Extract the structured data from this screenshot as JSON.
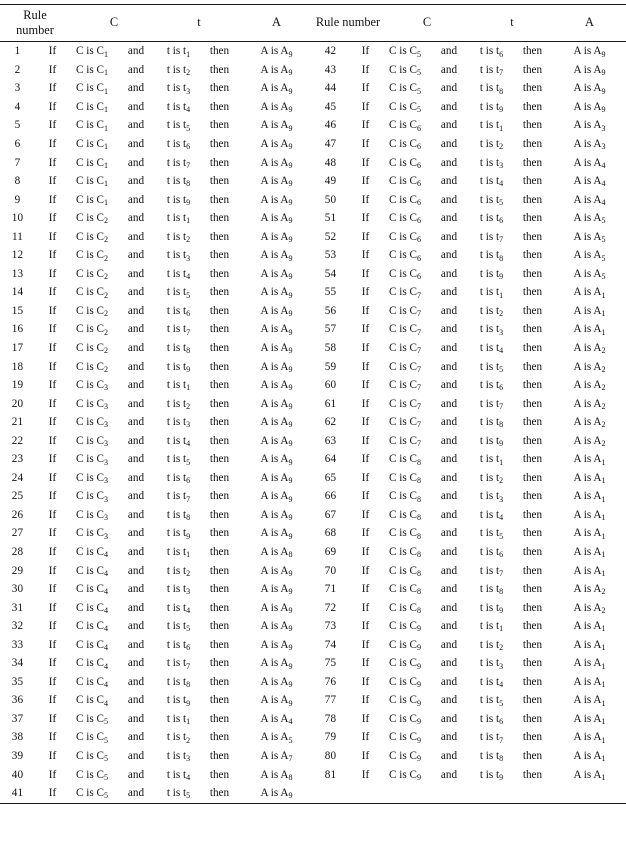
{
  "table": {
    "headers_left": {
      "rule_number_line1": "Rule",
      "rule_number_line2": "number",
      "c": "C",
      "t": "t",
      "a": "A"
    },
    "headers_right": {
      "rule_number": "Rule number",
      "c": "C",
      "t": "t",
      "a": "A"
    },
    "keywords": {
      "if": "If",
      "and": "and",
      "then": "then",
      "c_is": "C is C",
      "t_is": "t is t",
      "a_is": "A is A"
    },
    "rows_left": [
      {
        "n": "1",
        "c": "1",
        "t": "1",
        "a": "9"
      },
      {
        "n": "2",
        "c": "1",
        "t": "2",
        "a": "9"
      },
      {
        "n": "3",
        "c": "1",
        "t": "3",
        "a": "9"
      },
      {
        "n": "4",
        "c": "1",
        "t": "4",
        "a": "9"
      },
      {
        "n": "5",
        "c": "1",
        "t": "5",
        "a": "9"
      },
      {
        "n": "6",
        "c": "1",
        "t": "6",
        "a": "9"
      },
      {
        "n": "7",
        "c": "1",
        "t": "7",
        "a": "9"
      },
      {
        "n": "8",
        "c": "1",
        "t": "8",
        "a": "9"
      },
      {
        "n": "9",
        "c": "1",
        "t": "9",
        "a": "9"
      },
      {
        "n": "10",
        "c": "2",
        "t": "1",
        "a": "9"
      },
      {
        "n": "11",
        "c": "2",
        "t": "2",
        "a": "9"
      },
      {
        "n": "12",
        "c": "2",
        "t": "3",
        "a": "9"
      },
      {
        "n": "13",
        "c": "2",
        "t": "4",
        "a": "9"
      },
      {
        "n": "14",
        "c": "2",
        "t": "5",
        "a": "9"
      },
      {
        "n": "15",
        "c": "2",
        "t": "6",
        "a": "9"
      },
      {
        "n": "16",
        "c": "2",
        "t": "7",
        "a": "9"
      },
      {
        "n": "17",
        "c": "2",
        "t": "8",
        "a": "9"
      },
      {
        "n": "18",
        "c": "2",
        "t": "9",
        "a": "9"
      },
      {
        "n": "19",
        "c": "3",
        "t": "1",
        "a": "9"
      },
      {
        "n": "20",
        "c": "3",
        "t": "2",
        "a": "9"
      },
      {
        "n": "21",
        "c": "3",
        "t": "3",
        "a": "9"
      },
      {
        "n": "22",
        "c": "3",
        "t": "4",
        "a": "9"
      },
      {
        "n": "23",
        "c": "3",
        "t": "5",
        "a": "9"
      },
      {
        "n": "24",
        "c": "3",
        "t": "6",
        "a": "9"
      },
      {
        "n": "25",
        "c": "3",
        "t": "7",
        "a": "9"
      },
      {
        "n": "26",
        "c": "3",
        "t": "8",
        "a": "9"
      },
      {
        "n": "27",
        "c": "3",
        "t": "9",
        "a": "9"
      },
      {
        "n": "28",
        "c": "4",
        "t": "1",
        "a": "8"
      },
      {
        "n": "29",
        "c": "4",
        "t": "2",
        "a": "9"
      },
      {
        "n": "30",
        "c": "4",
        "t": "3",
        "a": "9"
      },
      {
        "n": "31",
        "c": "4",
        "t": "4",
        "a": "9"
      },
      {
        "n": "32",
        "c": "4",
        "t": "5",
        "a": "9"
      },
      {
        "n": "33",
        "c": "4",
        "t": "6",
        "a": "9"
      },
      {
        "n": "34",
        "c": "4",
        "t": "7",
        "a": "9"
      },
      {
        "n": "35",
        "c": "4",
        "t": "8",
        "a": "9"
      },
      {
        "n": "36",
        "c": "4",
        "t": "9",
        "a": "9"
      },
      {
        "n": "37",
        "c": "5",
        "t": "1",
        "a": "4"
      },
      {
        "n": "38",
        "c": "5",
        "t": "2",
        "a": "5"
      },
      {
        "n": "39",
        "c": "5",
        "t": "3",
        "a": "7"
      },
      {
        "n": "40",
        "c": "5",
        "t": "4",
        "a": "8"
      },
      {
        "n": "41",
        "c": "5",
        "t": "5",
        "a": "9"
      }
    ],
    "rows_right": [
      {
        "n": "42",
        "c": "5",
        "t": "6",
        "a": "9"
      },
      {
        "n": "43",
        "c": "5",
        "t": "7",
        "a": "9"
      },
      {
        "n": "44",
        "c": "5",
        "t": "8",
        "a": "9"
      },
      {
        "n": "45",
        "c": "5",
        "t": "9",
        "a": "9"
      },
      {
        "n": "46",
        "c": "6",
        "t": "1",
        "a": "3"
      },
      {
        "n": "47",
        "c": "6",
        "t": "2",
        "a": "3"
      },
      {
        "n": "48",
        "c": "6",
        "t": "3",
        "a": "4"
      },
      {
        "n": "49",
        "c": "6",
        "t": "4",
        "a": "4"
      },
      {
        "n": "50",
        "c": "6",
        "t": "5",
        "a": "4"
      },
      {
        "n": "51",
        "c": "6",
        "t": "6",
        "a": "5"
      },
      {
        "n": "52",
        "c": "6",
        "t": "7",
        "a": "5"
      },
      {
        "n": "53",
        "c": "6",
        "t": "8",
        "a": "5"
      },
      {
        "n": "54",
        "c": "6",
        "t": "9",
        "a": "5"
      },
      {
        "n": "55",
        "c": "7",
        "t": "1",
        "a": "1"
      },
      {
        "n": "56",
        "c": "7",
        "t": "2",
        "a": "1"
      },
      {
        "n": "57",
        "c": "7",
        "t": "3",
        "a": "1"
      },
      {
        "n": "58",
        "c": "7",
        "t": "4",
        "a": "2"
      },
      {
        "n": "59",
        "c": "7",
        "t": "5",
        "a": "2"
      },
      {
        "n": "60",
        "c": "7",
        "t": "6",
        "a": "2"
      },
      {
        "n": "61",
        "c": "7",
        "t": "7",
        "a": "2"
      },
      {
        "n": "62",
        "c": "7",
        "t": "8",
        "a": "2"
      },
      {
        "n": "63",
        "c": "7",
        "t": "9",
        "a": "2"
      },
      {
        "n": "64",
        "c": "8",
        "t": "1",
        "a": "1"
      },
      {
        "n": "65",
        "c": "8",
        "t": "2",
        "a": "1"
      },
      {
        "n": "66",
        "c": "8",
        "t": "3",
        "a": "1"
      },
      {
        "n": "67",
        "c": "8",
        "t": "4",
        "a": "1"
      },
      {
        "n": "68",
        "c": "8",
        "t": "5",
        "a": "1"
      },
      {
        "n": "69",
        "c": "8",
        "t": "6",
        "a": "1"
      },
      {
        "n": "70",
        "c": "8",
        "t": "7",
        "a": "1"
      },
      {
        "n": "71",
        "c": "8",
        "t": "8",
        "a": "2"
      },
      {
        "n": "72",
        "c": "8",
        "t": "9",
        "a": "2"
      },
      {
        "n": "73",
        "c": "9",
        "t": "1",
        "a": "1"
      },
      {
        "n": "74",
        "c": "9",
        "t": "2",
        "a": "1"
      },
      {
        "n": "75",
        "c": "9",
        "t": "3",
        "a": "1"
      },
      {
        "n": "76",
        "c": "9",
        "t": "4",
        "a": "1"
      },
      {
        "n": "77",
        "c": "9",
        "t": "5",
        "a": "1"
      },
      {
        "n": "78",
        "c": "9",
        "t": "6",
        "a": "1"
      },
      {
        "n": "79",
        "c": "9",
        "t": "7",
        "a": "1"
      },
      {
        "n": "80",
        "c": "9",
        "t": "8",
        "a": "1"
      },
      {
        "n": "81",
        "c": "9",
        "t": "9",
        "a": "1"
      }
    ]
  }
}
